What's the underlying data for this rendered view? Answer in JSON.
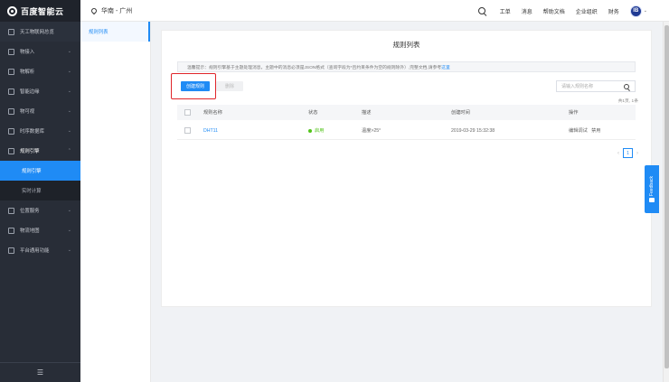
{
  "header": {
    "logo_text": "百度智能云",
    "region": "华南 - 广州",
    "links": [
      "工单",
      "消息",
      "帮助文档",
      "企业组织",
      "财务"
    ],
    "avatar_initials": "IB"
  },
  "sidebar": {
    "items": [
      {
        "label": "天工物联网总览",
        "icon": "grid-icon",
        "chevron": ""
      },
      {
        "label": "物接入",
        "icon": "device-access-icon",
        "chevron": "⌄"
      },
      {
        "label": "物解析",
        "icon": "parse-icon",
        "chevron": "⌄"
      },
      {
        "label": "智能边缘",
        "icon": "edge-icon",
        "chevron": "⌄"
      },
      {
        "label": "物可视",
        "icon": "eye-icon",
        "chevron": "⌄"
      },
      {
        "label": "时序数据库",
        "icon": "database-icon",
        "chevron": "⌄"
      },
      {
        "label": "规则引擎",
        "icon": "rule-engine-icon",
        "chevron": "⌃"
      }
    ],
    "sub_items": [
      {
        "label": "规则引擎",
        "active": true
      },
      {
        "label": "实时计算",
        "active": false
      }
    ],
    "items_after": [
      {
        "label": "位置服务",
        "icon": "location-icon",
        "chevron": "⌄"
      },
      {
        "label": "物流地图",
        "icon": "map-icon",
        "chevron": "⌄"
      },
      {
        "label": "平台通用功能",
        "icon": "platform-icon",
        "chevron": "⌄"
      }
    ],
    "bottom_icon": "☰"
  },
  "subcol": {
    "item": "规则列表"
  },
  "main": {
    "title": "规则列表",
    "tip_text": "温馨提示：规则引擎基于主题处理消息，主题中的消息必须是JSON格式（查询字段为*且约束条件为空的规则除外）,完整文档,请参考",
    "tip_link": "这里",
    "create_button": "创建规则",
    "delete_button": "删除",
    "search_placeholder": "请输入规则名称",
    "total": "共1页, 1条",
    "columns": {
      "name": "规则名称",
      "status": "状态",
      "desc": "描述",
      "time": "创建时间",
      "op": "操作"
    },
    "rows": [
      {
        "name": "DHT11",
        "status": "启用",
        "desc": "温度>25°",
        "time": "2019-03-29 15:32:38",
        "op_edit": "编辑调试",
        "op_disable": "禁用"
      }
    ],
    "pager": {
      "prev": "‹",
      "current": "1",
      "next": "›"
    }
  },
  "feedback": {
    "label": "Feedback"
  },
  "colors": {
    "accent": "#1f8bf5",
    "sidebar_bg": "#282d37",
    "highlight": "#e0252a",
    "status_ok": "#52c41a"
  }
}
